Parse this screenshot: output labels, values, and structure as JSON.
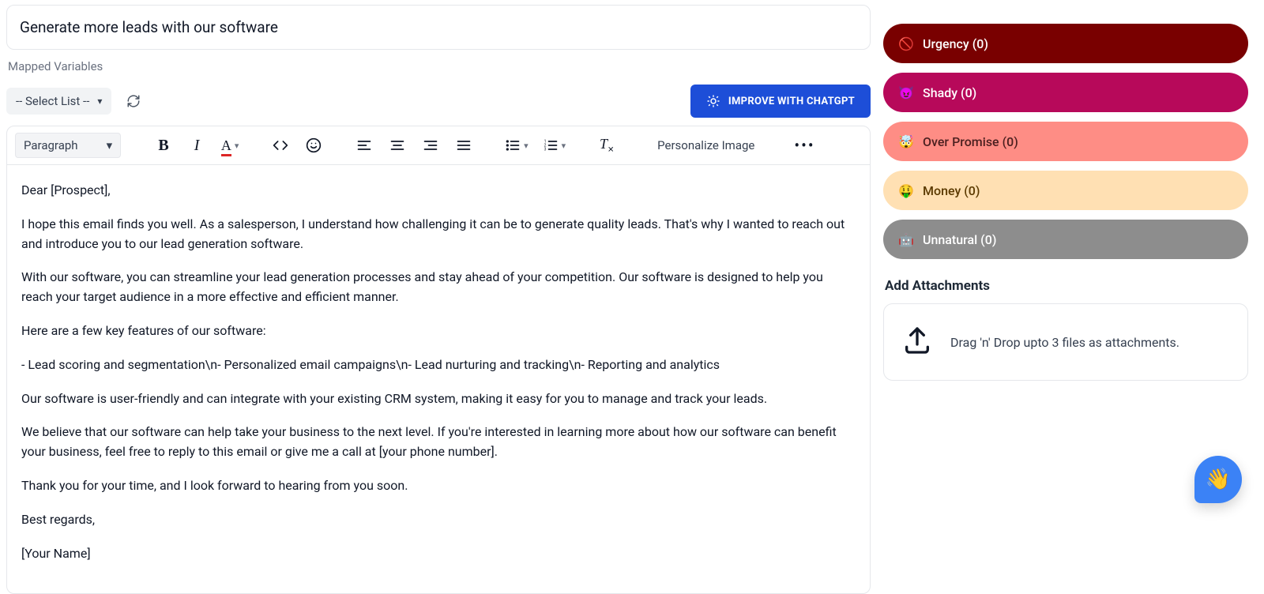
{
  "subject": "Generate more leads with our software",
  "mapped_variables_label": "Mapped Variables",
  "select_list_label": "-- Select List --",
  "improve_button": "IMPROVE WITH CHATGPT",
  "block_style_label": "Paragraph",
  "personalize_label": "Personalize Image",
  "body": {
    "p1": "Dear [Prospect],",
    "p2": "I hope this email finds you well. As a salesperson, I understand how challenging it can be to generate quality leads. That's why I wanted to reach out and introduce you to our lead generation software.",
    "p3": "With our software, you can streamline your lead generation processes and stay ahead of your competition. Our software is designed to help you reach your target audience in a more effective and efficient manner.",
    "p4": "Here are a few key features of our software:",
    "p5": "- Lead scoring and segmentation\\n- Personalized email campaigns\\n- Lead nurturing and tracking\\n- Reporting and analytics",
    "p6": "Our software is user-friendly and can integrate with your existing CRM system, making it easy for you to manage and track your leads.",
    "p7": "We believe that our software can help take your business to the next level. If you're interested in learning more about how our software can benefit your business, feel free to reply to this email or give me a call at [your phone number].",
    "p8": "Thank you for your time, and I look forward to hearing from you soon.",
    "p9": "Best regards,",
    "p10": "[Your Name]"
  },
  "spam": {
    "urgency": {
      "label": "Urgency (0)",
      "icon": "🚫"
    },
    "shady": {
      "label": "Shady (0)",
      "icon": "😈"
    },
    "overpromise": {
      "label": "Over Promise (0)",
      "icon": "🤯"
    },
    "money": {
      "label": "Money (0)",
      "icon": "🤑"
    },
    "unnatural": {
      "label": "Unnatural (0)",
      "icon": "🤖"
    }
  },
  "attachments": {
    "title": "Add Attachments",
    "help": "Drag 'n' Drop upto 3 files as attachments."
  },
  "fab_emoji": "👋"
}
